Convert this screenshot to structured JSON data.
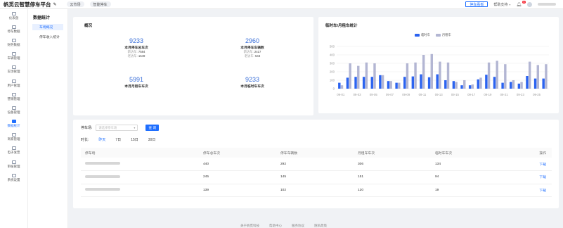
{
  "app": {
    "title": "帆觅云智慧停车平台"
  },
  "top_tabs": [
    {
      "label": "云市场"
    },
    {
      "label": "智能停车"
    }
  ],
  "header": {
    "parking_board": "停车看板",
    "help": "帮助支持",
    "notif_count": "6"
  },
  "icon_nav": [
    {
      "label": "仪表盘"
    },
    {
      "label": "停车数据"
    },
    {
      "label": "财务数据"
    },
    {
      "label": "车辆管理"
    },
    {
      "label": "车场管理"
    },
    {
      "label": "用户管理"
    },
    {
      "label": "营销管理"
    },
    {
      "label": "设备管理"
    },
    {
      "label": "数据统计",
      "active": true
    },
    {
      "label": "商家管理"
    },
    {
      "label": "电子发票"
    },
    {
      "label": "审核管理"
    },
    {
      "label": "系统设置"
    }
  ],
  "sub_nav": {
    "title": "数据统计",
    "items": [
      {
        "label": "车场概况",
        "active": true
      },
      {
        "label": "停车收入统计"
      }
    ]
  },
  "overview": {
    "title": "概况",
    "stats": [
      {
        "value": "9233",
        "label": "本月停车总车次",
        "sub": [
          {
            "k": "新访车",
            "v": "7584"
          },
          {
            "k": "老访车",
            "v": "1649"
          }
        ]
      },
      {
        "value": "2960",
        "label": "本月停车车辆数",
        "sub": [
          {
            "k": "新访车",
            "v": "2417"
          },
          {
            "k": "老访车",
            "v": "543"
          }
        ]
      },
      {
        "value": "5991",
        "label": "本月月租车车次",
        "sub": []
      },
      {
        "value": "9233",
        "label": "本月临时车车次",
        "sub": []
      }
    ]
  },
  "chart_card": {
    "title": "临时车/月租车统计"
  },
  "chart_data": {
    "type": "bar",
    "title": "临时车/月租车统计",
    "ylim": [
      0,
      500
    ],
    "yticks": [
      "0",
      "100",
      "200",
      "300",
      "400",
      "500"
    ],
    "xtick_labels": [
      "09-01",
      "09-03",
      "09-05",
      "09-07",
      "09-09",
      "09-11",
      "09-13",
      "09-15",
      "09-17",
      "09-19",
      "09-21",
      "09-23",
      "09-25"
    ],
    "categories": [
      "09-01",
      "09-02",
      "09-03",
      "09-04",
      "09-05",
      "09-06",
      "09-07",
      "09-08",
      "09-09",
      "09-10",
      "09-11",
      "09-12",
      "09-13",
      "09-14",
      "09-15",
      "09-16",
      "09-17",
      "09-18",
      "09-19",
      "09-20",
      "09-21",
      "09-22",
      "09-23",
      "09-24",
      "09-25",
      "09-26"
    ],
    "series": [
      {
        "name": "临时车",
        "color": "#2b63f0",
        "values": [
          70,
          130,
          140,
          140,
          140,
          160,
          90,
          70,
          140,
          145,
          170,
          135,
          170,
          100,
          90,
          40,
          40,
          110,
          165,
          140,
          70,
          80,
          60,
          150,
          120,
          120
        ]
      },
      {
        "name": "月租车",
        "color": "#b3b6d3",
        "values": [
          40,
          300,
          270,
          310,
          300,
          160,
          90,
          70,
          300,
          310,
          400,
          410,
          320,
          310,
          80,
          100,
          50,
          130,
          310,
          330,
          290,
          100,
          80,
          320,
          280,
          290
        ]
      }
    ],
    "legend": "top-center",
    "grid": true
  },
  "filters": {
    "lot_label": "停车场:",
    "lot_placeholder": "请选择停车场",
    "query_button": "查 询",
    "time_label": "时长:",
    "time_options": [
      {
        "label": "昨天",
        "active": true
      },
      {
        "label": "7日"
      },
      {
        "label": "15日"
      },
      {
        "label": "30日"
      }
    ]
  },
  "table": {
    "columns": [
      "停车场",
      "停车总车次",
      "停车车辆数",
      "月租车车次",
      "临时车车次",
      "操作"
    ],
    "rows": [
      {
        "lot": "",
        "total": "440",
        "vehicles": "292",
        "monthly": "306",
        "temporary": "134",
        "action": "下载"
      },
      {
        "lot": "",
        "total": "245",
        "vehicles": "145",
        "monthly": "151",
        "temporary": "94",
        "action": "下载"
      },
      {
        "lot": "",
        "total": "139",
        "vehicles": "102",
        "monthly": "120",
        "temporary": "19",
        "action": "下载"
      }
    ]
  },
  "footer": {
    "links": [
      "关于帆觅科技",
      "帮助中心",
      "服务协议",
      "隐私政策"
    ]
  }
}
